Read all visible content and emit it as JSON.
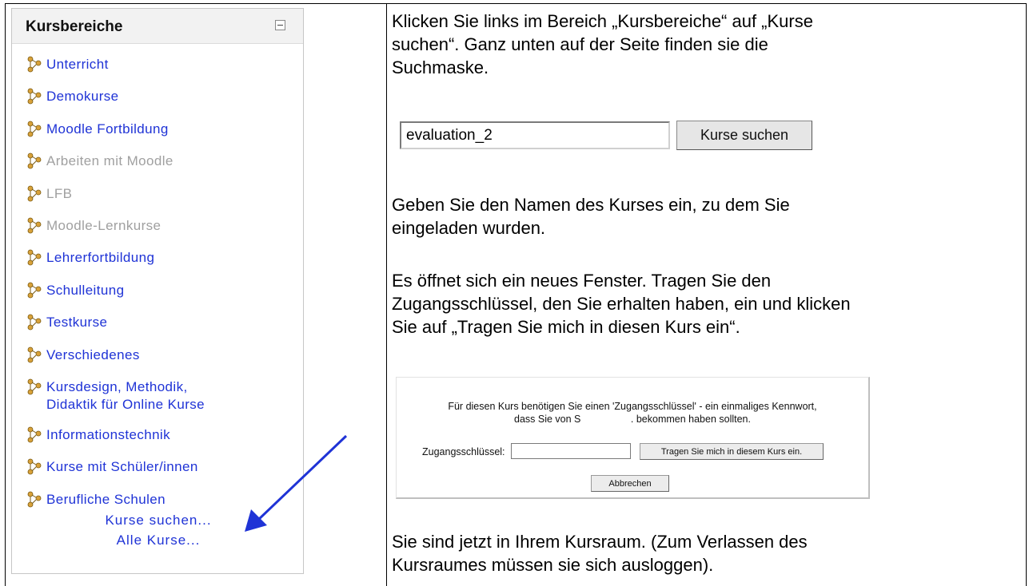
{
  "block": {
    "title": "Kursbereiche",
    "categories": [
      {
        "label": "Unterricht",
        "dimmed": false
      },
      {
        "label": "Demokurse",
        "dimmed": false
      },
      {
        "label": "Moodle Fortbildung",
        "dimmed": false
      },
      {
        "label": "Arbeiten mit Moodle",
        "dimmed": true
      },
      {
        "label": "LFB",
        "dimmed": true
      },
      {
        "label": "Moodle-Lernkurse",
        "dimmed": true
      },
      {
        "label": "Lehrerfortbildung",
        "dimmed": false
      },
      {
        "label": "Schulleitung",
        "dimmed": false
      },
      {
        "label": "Testkurse",
        "dimmed": false
      },
      {
        "label": "Verschiedenes",
        "dimmed": false
      },
      {
        "label": "Kursdesign, Methodik,",
        "label2": "Didaktik für Online Kurse",
        "dimmed": false
      },
      {
        "label": "Informationstechnik",
        "dimmed": false
      },
      {
        "label": "Kurse mit Schüler/innen",
        "dimmed": false
      },
      {
        "label": "Berufliche Schulen",
        "dimmed": false
      }
    ],
    "search_link": "Kurse suchen...",
    "all_link": "Alle Kurse..."
  },
  "instructions": {
    "p1_line1": "Klicken Sie links im Bereich „Kursbereiche“ auf „Kurse",
    "p1_line2": "suchen“. Ganz unten auf der Seite finden sie die",
    "p1_line3": "Suchmaske.",
    "p2_line1": "Geben Sie den Namen des Kurses ein, zu dem Sie",
    "p2_line2": "eingeladen wurden.",
    "p3_line1": "Es öffnet sich ein neues Fenster. Tragen Sie den",
    "p3_line2": "Zugangsschlüssel, den Sie erhalten haben, ein und klicken",
    "p3_line3": "Sie auf „Tragen Sie mich in diesen Kurs ein“.",
    "p4_line1": "Sie sind jetzt in Ihrem Kursraum. (Zum Verlassen des",
    "p4_line2": "Kursraumes müssen sie sich ausloggen)."
  },
  "search": {
    "value": "evaluation_2",
    "button": "Kurse suchen"
  },
  "enrol": {
    "line1": "Für diesen Kurs benötigen Sie einen 'Zugangsschlüssel' - ein einmaliges Kennwort,",
    "line2": "dass Sie von S                  . bekommen haben sollten.",
    "key_label": "Zugangsschlüssel:",
    "enrol_button": "Tragen Sie mich in diesem Kurs ein.",
    "cancel_button": "Abbrechen"
  },
  "colors": {
    "link": "#1f33d6",
    "dimmed": "#a0a0a0",
    "arrow": "#1f33d6"
  }
}
